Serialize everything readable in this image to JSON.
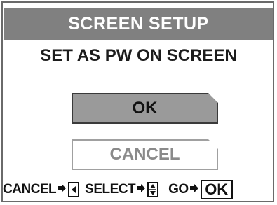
{
  "dialog": {
    "title": "SCREEN SETUP",
    "prompt": "SET AS PW ON SCREEN"
  },
  "menu": {
    "options": [
      {
        "label": "OK",
        "selected": true
      },
      {
        "label": "CANCEL",
        "selected": false
      }
    ]
  },
  "hints": {
    "cancel_label": "CANCEL",
    "cancel_key_icon": "left-arrow-key-icon",
    "select_label": "SELECT",
    "select_key_icon": "up-down-arrow-key-icon",
    "go_label": "GO",
    "go_key_label": "OK"
  },
  "colors": {
    "title_bg": "#808080",
    "selected_bg": "#9a9a9a",
    "unselected_text": "#8a8a8a"
  }
}
